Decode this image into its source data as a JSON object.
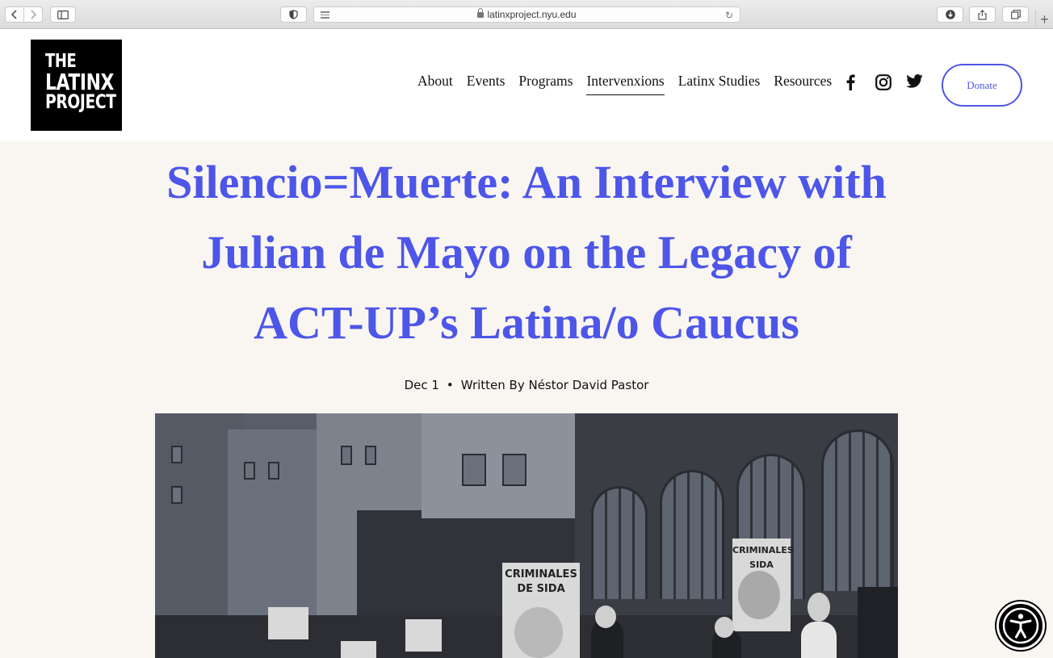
{
  "browser": {
    "url": "latinxproject.nyu.edu"
  },
  "site": {
    "logo_lines": [
      "THE",
      "LATINX",
      "PROJECT"
    ],
    "nav": [
      {
        "label": "About",
        "active": false
      },
      {
        "label": "Events",
        "active": false
      },
      {
        "label": "Programs",
        "active": false
      },
      {
        "label": "Intervenxions",
        "active": true
      },
      {
        "label": "Latinx Studies",
        "active": false
      },
      {
        "label": "Resources",
        "active": false
      }
    ],
    "social_icons": [
      "facebook-icon",
      "instagram-icon",
      "twitter-icon"
    ],
    "donate_label": "Donate"
  },
  "article": {
    "title_lines": [
      "Silencio=Muerte: An Interview with",
      "Julian de Mayo on the Legacy of",
      "ACT-UP’s Latina/o Caucus"
    ],
    "date": "Dec 1",
    "separator": "•",
    "byline": "Written By Néstor David Pastor",
    "photo_signs": [
      "CRIMINALES DE SIDA",
      "CRIMINALES SIDA"
    ]
  },
  "colors": {
    "accent": "#4d56e8",
    "page_bg": "#f9f6f1",
    "header_bg": "#ffffff"
  }
}
